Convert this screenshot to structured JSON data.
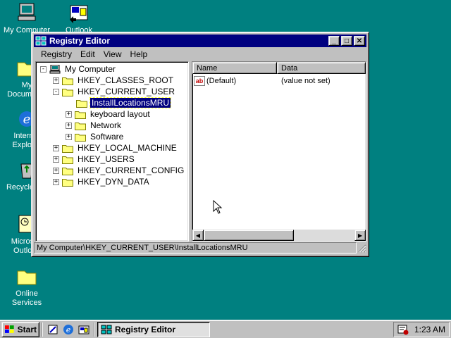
{
  "desktop": {
    "icons": [
      {
        "label": "My Computer",
        "icon": "my-computer-icon"
      },
      {
        "label": "Outlook",
        "icon": "outlook-icon"
      },
      {
        "label": "My Documents",
        "icon": "folder-icon"
      },
      {
        "label": "Internet Explorer",
        "icon": "ie-icon"
      },
      {
        "label": "Recycle Bin",
        "icon": "recycle-bin-icon"
      },
      {
        "label": "Microsoft Outlook",
        "icon": "outlook-icon"
      },
      {
        "label": "Online Services",
        "icon": "folder-icon"
      }
    ]
  },
  "window": {
    "title": "Registry Editor",
    "menu": [
      "Registry",
      "Edit",
      "View",
      "Help"
    ],
    "tree": [
      {
        "label": "My Computer",
        "expander": "-",
        "level": 0
      },
      {
        "label": "HKEY_CLASSES_ROOT",
        "expander": "+",
        "level": 1
      },
      {
        "label": "HKEY_CURRENT_USER",
        "expander": "-",
        "level": 1
      },
      {
        "label": "InstallLocationsMRU",
        "expander": "",
        "level": 2,
        "selected": true
      },
      {
        "label": "keyboard layout",
        "expander": "+",
        "level": 2
      },
      {
        "label": "Network",
        "expander": "+",
        "level": 2
      },
      {
        "label": "Software",
        "expander": "+",
        "level": 2
      },
      {
        "label": "HKEY_LOCAL_MACHINE",
        "expander": "+",
        "level": 1
      },
      {
        "label": "HKEY_USERS",
        "expander": "+",
        "level": 1
      },
      {
        "label": "HKEY_CURRENT_CONFIG",
        "expander": "+",
        "level": 1
      },
      {
        "label": "HKEY_DYN_DATA",
        "expander": "+",
        "level": 1
      }
    ],
    "columns": {
      "name": "Name",
      "data": "Data"
    },
    "values": [
      {
        "name": "(Default)",
        "data": "(value not set)",
        "icon": "string-value-icon"
      }
    ],
    "status": "My Computer\\HKEY_CURRENT_USER\\InstallLocationsMRU"
  },
  "taskbar": {
    "start_label": "Start",
    "task_label": "Registry Editor",
    "clock": "1:23 AM"
  },
  "colors": {
    "desktop": "#008080",
    "title_bar": "#000080",
    "face": "#c0c0c0"
  }
}
